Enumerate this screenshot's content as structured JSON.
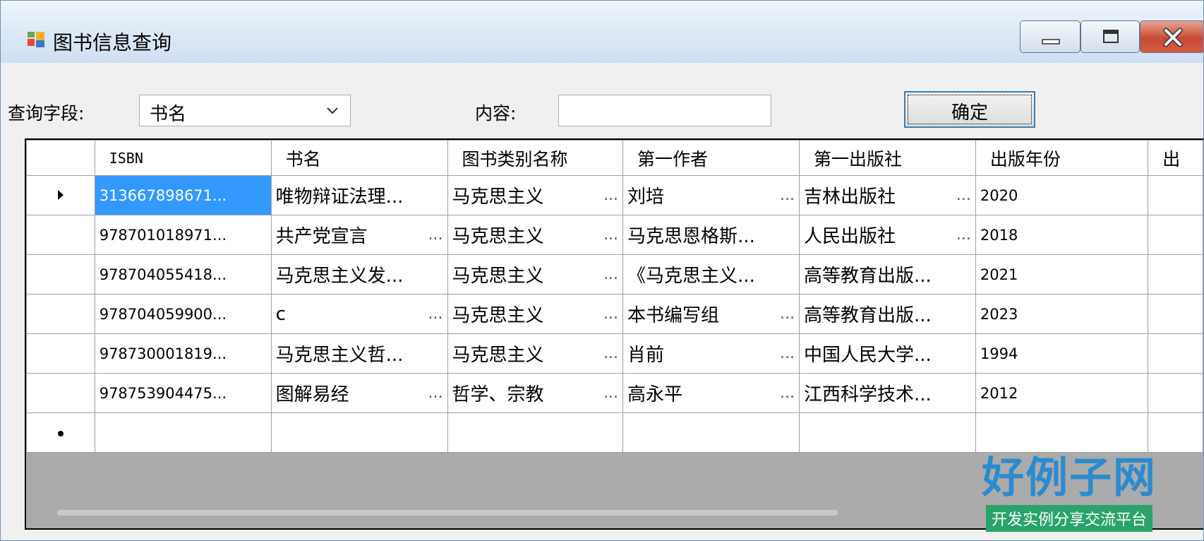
{
  "window": {
    "title": "图书信息查询",
    "buttons": {
      "minimize": "minimize",
      "maximize": "maximize",
      "close": "close"
    }
  },
  "query": {
    "field_label": "查询字段:",
    "field_value": "书名",
    "content_label": "内容:",
    "content_value": "",
    "confirm_label": "确定"
  },
  "grid": {
    "columns": [
      "ISBN",
      "书名",
      "图书类别名称",
      "第一作者",
      "第一出版社",
      "出版年份",
      "出"
    ],
    "rows": [
      [
        "313667898671...",
        "唯物辩证法理...",
        "马克思主义",
        "刘培",
        "吉林出版社",
        "2020"
      ],
      [
        "978701018971...",
        "共产党宣言",
        "马克思主义",
        "马克思恩格斯...",
        "人民出版社",
        "2018"
      ],
      [
        "978704055418...",
        "马克思主义发...",
        "马克思主义",
        "《马克思主义...",
        "高等教育出版...",
        "2021"
      ],
      [
        "978704059900...",
        "c",
        "马克思主义",
        "本书编写组",
        "高等教育出版...",
        "2023"
      ],
      [
        "978730001819...",
        "马克思主义哲...",
        "马克思主义",
        "肖前",
        "中国人民大学...",
        "1994"
      ],
      [
        "978753904475...",
        "图解易经",
        "哲学、宗教",
        "高永平",
        "江西科学技术...",
        "2012"
      ]
    ],
    "truncation_marker": "...",
    "selected_row": 0
  },
  "watermark": {
    "main": "好例子网",
    "sub": "开发实例分享交流平台"
  },
  "colors": {
    "selection": "#3399ff",
    "grid_background": "#ababab",
    "watermark_blue": "#2a8bd0",
    "watermark_green": "#2aa36b"
  }
}
